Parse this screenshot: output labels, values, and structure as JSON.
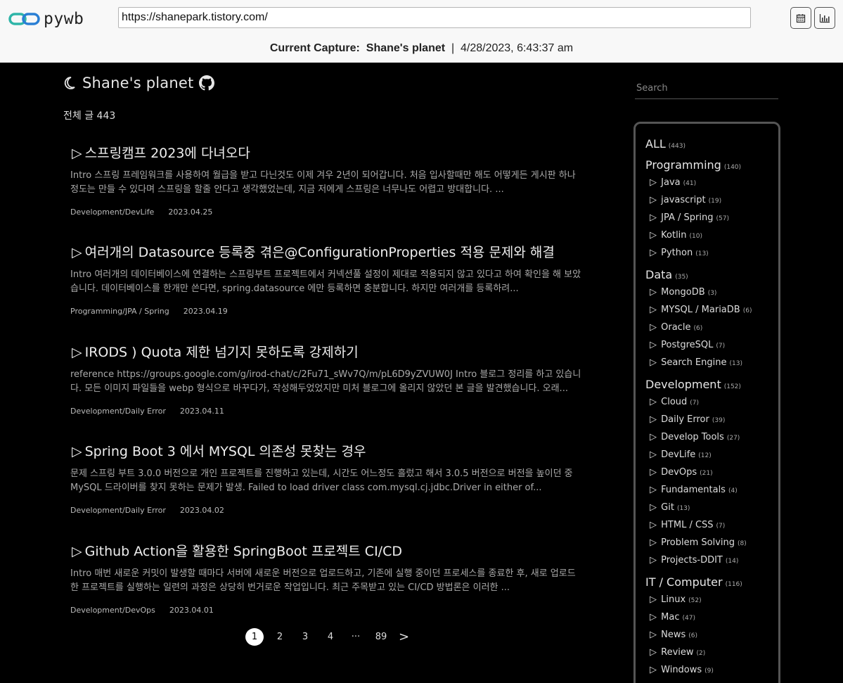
{
  "header": {
    "logo_text": "pywb",
    "url": "https://shanepark.tistory.com/",
    "capture_label": "Current Capture:",
    "capture_title": "Shane's planet",
    "separator": "|",
    "capture_datetime": "4/28/2023, 6:43:37 am",
    "calendar_icon": "calendar-icon",
    "timeline_icon": "chart-icon"
  },
  "blog": {
    "title": "Shane's planet",
    "moon_icon": "moon-icon",
    "github_icon": "github-icon",
    "total_posts": "전체 글 443"
  },
  "posts": [
    {
      "title": "스프링캠프 2023에 다녀오다",
      "excerpt": "Intro 스프링 프레임워크를 사용하여 월급을 받고 다닌것도 이제 겨우 2년이 되어갑니다. 처음 입사할때만 해도 어떻게든 게시판 하나정도는 만들 수 있다며 스프링을 할줄 안다고 생각했었는데, 지금 저에게 스프링은 너무나도 어렵고 방대합니다. ...",
      "category": "Development/DevLife",
      "date": "2023.04.25"
    },
    {
      "title": "여러개의 Datasource 등록중 겪은@ConfigurationProperties 적용 문제와 해결",
      "excerpt": "Intro 여러개의 데이터베이스에 연결하는 스프링부트 프로젝트에서 커넥션풀 설정이 제대로 적용되지 않고 있다고 하여 확인을 해 보았습니다. 데이터베이스를 한개만 쓴다면, spring.datasource 에만 등록하면 충분합니다. 하지만 여러개를 등록하려...",
      "category": "Programming/JPA / Spring",
      "date": "2023.04.19"
    },
    {
      "title": "IRODS ) Quota 제한 넘기지 못하도록 강제하기",
      "excerpt": "reference https://groups.google.com/g/irod-chat/c/2Fu71_sWv7Q/m/pL6D9yZVUW0J Intro 블로그 정리를 하고 있습니다. 모든 이미지 파일들을 webp 형식으로 바꾸다가, 작성해두었었지만 미처 블로그에 올리지 않았던 본 글을 발견했습니다. 오래...",
      "category": "Development/Daily Error",
      "date": "2023.04.11"
    },
    {
      "title": "Spring Boot 3 에서 MYSQL 의존성 못찾는 경우",
      "excerpt": "문제 스프링 부트 3.0.0 버전으로 개인 프로젝트를 진행하고 있는데, 시간도 어느정도 흘렀고 해서 3.0.5 버전으로 버전을 높이던 중 MySQL 드라이버를 찾지 못하는 문제가 발생. Failed to load driver class com.mysql.cj.jdbc.Driver in either of...",
      "category": "Development/Daily Error",
      "date": "2023.04.02"
    },
    {
      "title": "Github Action을 활용한 SpringBoot 프로젝트 CI/CD",
      "excerpt": "Intro 매번 새로운 커밋이 발생할 때마다 서버에 새로운 버전으로 업로드하고, 기존에 실행 중이던 프로세스를 종료한 후, 새로 업로드한 프로젝트를 실행하는 일련의 과정은 상당히 번거로운 작업입니다. 최근 주목받고 있는 CI/CD 방법론은 이러한 ...",
      "category": "Development/DevOps",
      "date": "2023.04.01"
    }
  ],
  "pagination": {
    "pages": [
      "1",
      "2",
      "3",
      "4",
      "···",
      "89"
    ],
    "current": "1",
    "next": ">"
  },
  "sidebar": {
    "search_placeholder": "Search",
    "categories": [
      {
        "label": "ALL",
        "count": "(443)",
        "children": []
      },
      {
        "label": "Programming",
        "count": "(140)",
        "children": [
          {
            "label": "Java",
            "count": "(41)"
          },
          {
            "label": "javascript",
            "count": "(19)"
          },
          {
            "label": "JPA / Spring",
            "count": "(57)"
          },
          {
            "label": "Kotlin",
            "count": "(10)"
          },
          {
            "label": "Python",
            "count": "(13)"
          }
        ]
      },
      {
        "label": "Data",
        "count": "(35)",
        "children": [
          {
            "label": "MongoDB",
            "count": "(3)"
          },
          {
            "label": "MYSQL / MariaDB",
            "count": "(6)"
          },
          {
            "label": "Oracle",
            "count": "(6)"
          },
          {
            "label": "PostgreSQL",
            "count": "(7)"
          },
          {
            "label": "Search Engine",
            "count": "(13)"
          }
        ]
      },
      {
        "label": "Development",
        "count": "(152)",
        "children": [
          {
            "label": "Cloud",
            "count": "(7)"
          },
          {
            "label": "Daily Error",
            "count": "(39)"
          },
          {
            "label": "Develop Tools",
            "count": "(27)"
          },
          {
            "label": "DevLife",
            "count": "(12)"
          },
          {
            "label": "DevOps",
            "count": "(21)"
          },
          {
            "label": "Fundamentals",
            "count": "(4)"
          },
          {
            "label": "Git",
            "count": "(13)"
          },
          {
            "label": "HTML / CSS",
            "count": "(7)"
          },
          {
            "label": "Problem Solving",
            "count": "(8)"
          },
          {
            "label": "Projects-DDIT",
            "count": "(14)"
          }
        ]
      },
      {
        "label": "IT / Computer",
        "count": "(116)",
        "children": [
          {
            "label": "Linux",
            "count": "(52)"
          },
          {
            "label": "Mac",
            "count": "(47)"
          },
          {
            "label": "News",
            "count": "(6)"
          },
          {
            "label": "Review",
            "count": "(2)"
          },
          {
            "label": "Windows",
            "count": "(9)"
          }
        ]
      }
    ]
  },
  "colors": {
    "background": "#000000",
    "header_bg": "#f8f8f8",
    "logo_teal": "#2fb5a8",
    "logo_blue": "#2a7fd4"
  }
}
